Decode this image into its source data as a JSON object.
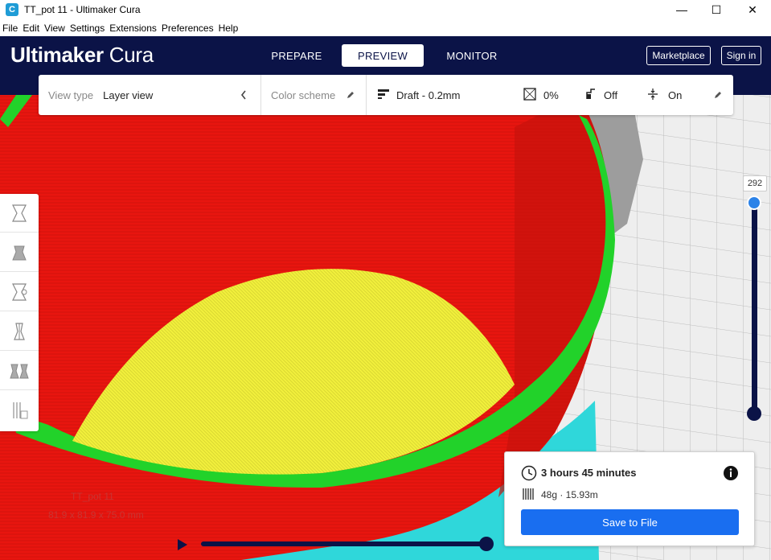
{
  "window": {
    "title": "TT_pot 11 - Ultimaker Cura",
    "app_icon_letter": "C",
    "minimize": "—",
    "maximize": "☐",
    "close": "✕"
  },
  "menubar": [
    "File",
    "Edit",
    "View",
    "Settings",
    "Extensions",
    "Preferences",
    "Help"
  ],
  "header": {
    "logo_bold": "Ultimaker",
    "logo_light": "Cura",
    "tabs": [
      {
        "label": "PREPARE",
        "active": false
      },
      {
        "label": "PREVIEW",
        "active": true
      },
      {
        "label": "MONITOR",
        "active": false
      }
    ],
    "marketplace_label": "Marketplace",
    "signin_label": "Sign in"
  },
  "toolbar": {
    "view_type_label": "View type",
    "view_type_value": "Layer view",
    "color_scheme_label": "Color scheme",
    "profile": "Draft - 0.2mm",
    "infill": "0%",
    "support": "Off",
    "adhesion": "On"
  },
  "layer_slider": {
    "current_layer": "292"
  },
  "object_info": {
    "name": "TT_pot 11",
    "dimensions": "81.9 x 81.9 x 75.0 mm"
  },
  "print_info": {
    "time": "3 hours 45 minutes",
    "material": "48g · 15.93m",
    "save_label": "Save to File"
  },
  "colors": {
    "header_bg": "#0b1347",
    "accent_blue": "#196ef0",
    "wall_red": "#e8150f",
    "skin_yellow": "#f0ef3a",
    "outer_green": "#22d22a",
    "skirt_cyan": "#2fd7da"
  },
  "icons": [
    "clock-icon",
    "info-icon",
    "spool-icon",
    "pencil-icon",
    "chevron-left-icon",
    "profile-icon",
    "infill-icon",
    "support-icon",
    "adhesion-icon",
    "play-icon"
  ]
}
